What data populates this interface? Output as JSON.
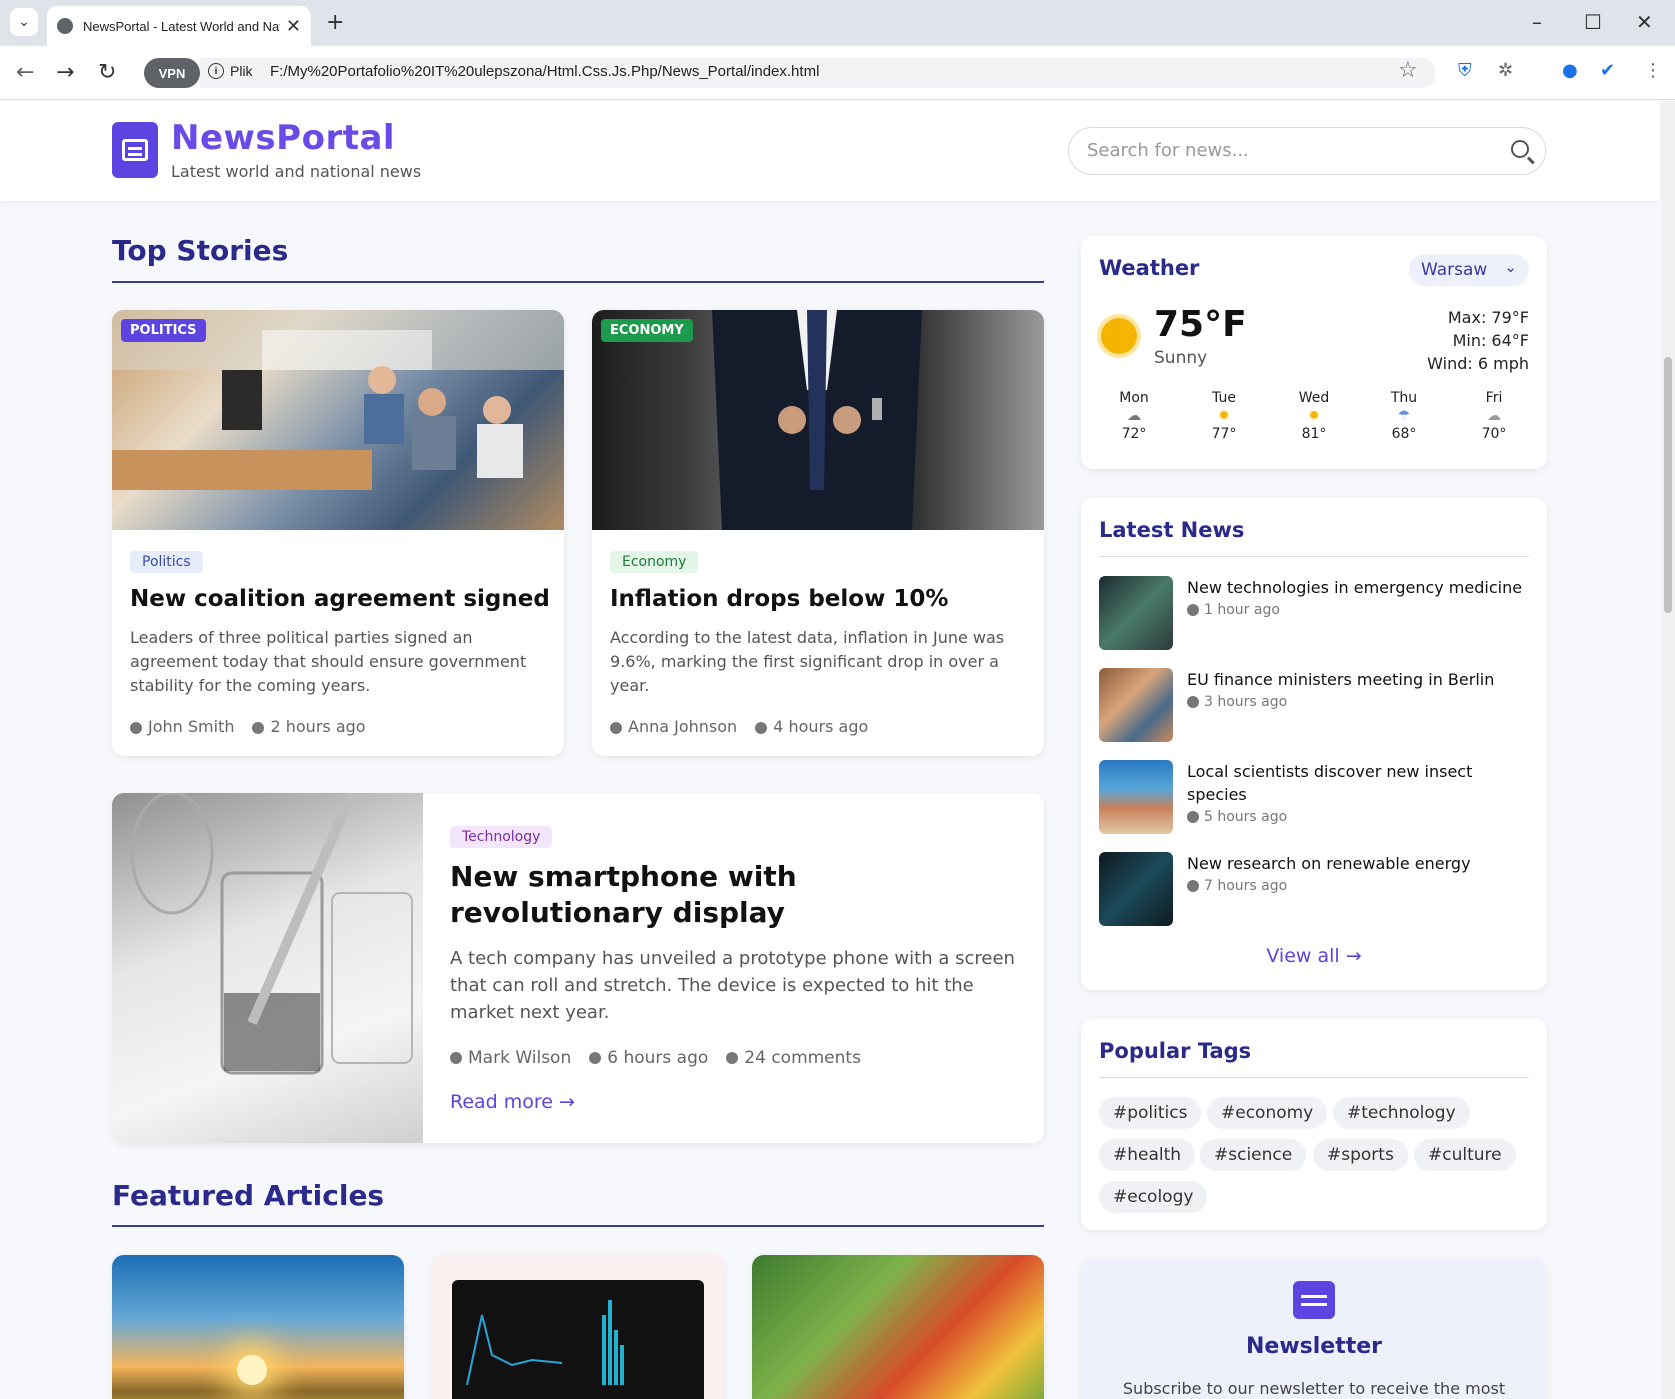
{
  "browser": {
    "tab_title": "NewsPortal - Latest World and Nat",
    "vpn_label": "VPN",
    "site_info_label": "Plik",
    "url": "F:/My%20Portafolio%20IT%20ulepszona/Html.Css.Js.Php/News_Portal/index.html"
  },
  "header": {
    "brand": "NewsPortal",
    "tagline": "Latest world and national news",
    "search_placeholder": "Search for news..."
  },
  "top_stories": {
    "title": "Top Stories",
    "cards": [
      {
        "badge": "POLITICS",
        "badge_color": "#5b44e0",
        "category": "Politics",
        "title": "New coalition agreement signed",
        "text": "Leaders of three political parties signed an agreement today that should ensure government stability for the coming years.",
        "author": "John Smith",
        "time": "2 hours ago"
      },
      {
        "badge": "ECONOMY",
        "badge_color": "#1d9b4d",
        "category": "Economy",
        "title": "Inflation drops below 10%",
        "text": "According to the latest data, inflation in June was 9.6%, marking the first significant drop in over a year.",
        "author": "Anna Johnson",
        "time": "4 hours ago"
      }
    ],
    "wide": {
      "category": "Technology",
      "title": "New smartphone with revolutionary display",
      "text": "A tech company has unveiled a prototype phone with a screen that can roll and stretch. The device is expected to hit the market next year.",
      "author": "Mark Wilson",
      "time": "6 hours ago",
      "comments": "24 comments",
      "read_more": "Read more →"
    }
  },
  "featured": {
    "title": "Featured Articles"
  },
  "weather": {
    "title": "Weather",
    "city": "Warsaw",
    "temp": "75°F",
    "condition": "Sunny",
    "max": "Max: 79°F",
    "min": "Min: 64°F",
    "wind": "Wind: 6 mph",
    "forecast": [
      {
        "day": "Mon",
        "temp": "72°",
        "icon": "partly-cloudy-icon"
      },
      {
        "day": "Tue",
        "temp": "77°",
        "icon": "sun-icon"
      },
      {
        "day": "Wed",
        "temp": "81°",
        "icon": "sun-icon"
      },
      {
        "day": "Thu",
        "temp": "68°",
        "icon": "rain-icon"
      },
      {
        "day": "Fri",
        "temp": "70°",
        "icon": "cloud-icon"
      }
    ]
  },
  "latest": {
    "title": "Latest News",
    "items": [
      {
        "title": "New technologies in emergency medicine",
        "time": "1 hour ago"
      },
      {
        "title": "EU finance ministers meeting in Berlin",
        "time": "3 hours ago"
      },
      {
        "title": "Local scientists discover new insect species",
        "time": "5 hours ago"
      },
      {
        "title": "New research on renewable energy",
        "time": "7 hours ago"
      }
    ],
    "view_all": "View all →"
  },
  "tags": {
    "title": "Popular Tags",
    "items": [
      "#politics",
      "#economy",
      "#technology",
      "#health",
      "#science",
      "#sports",
      "#culture",
      "#ecology"
    ]
  },
  "newsletter": {
    "title": "Newsletter",
    "text": "Subscribe to our newsletter to receive the most"
  },
  "colors": {
    "accent": "#5b44e0",
    "heading": "#2b2a8a",
    "sun": "#f5b400"
  }
}
